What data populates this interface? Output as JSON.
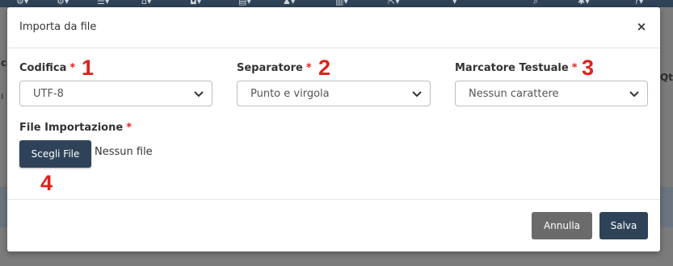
{
  "colors": {
    "primary": "#2f4358",
    "required": "#dd2222",
    "annotation": "#e0201b",
    "cancel": "#6b6b6b"
  },
  "background": {
    "fragments": [
      "ca",
      "ı",
      "Qt"
    ]
  },
  "modal": {
    "title": "Importa da file",
    "close_glyph": "×",
    "required_mark": "*",
    "fields": {
      "encoding": {
        "label": "Codifica",
        "value": "UTF-8",
        "annotation": "1"
      },
      "separator": {
        "label": "Separatore",
        "value": "Punto e virgola",
        "annotation": "2"
      },
      "text_marker": {
        "label": "Marcatore Testuale",
        "value": "Nessun carattere",
        "annotation": "3"
      },
      "import_file": {
        "label": "File Importazione",
        "button": "Scegli File",
        "status": "Nessun file",
        "annotation": "4"
      }
    },
    "footer": {
      "cancel": "Annulla",
      "save": "Salva"
    }
  }
}
